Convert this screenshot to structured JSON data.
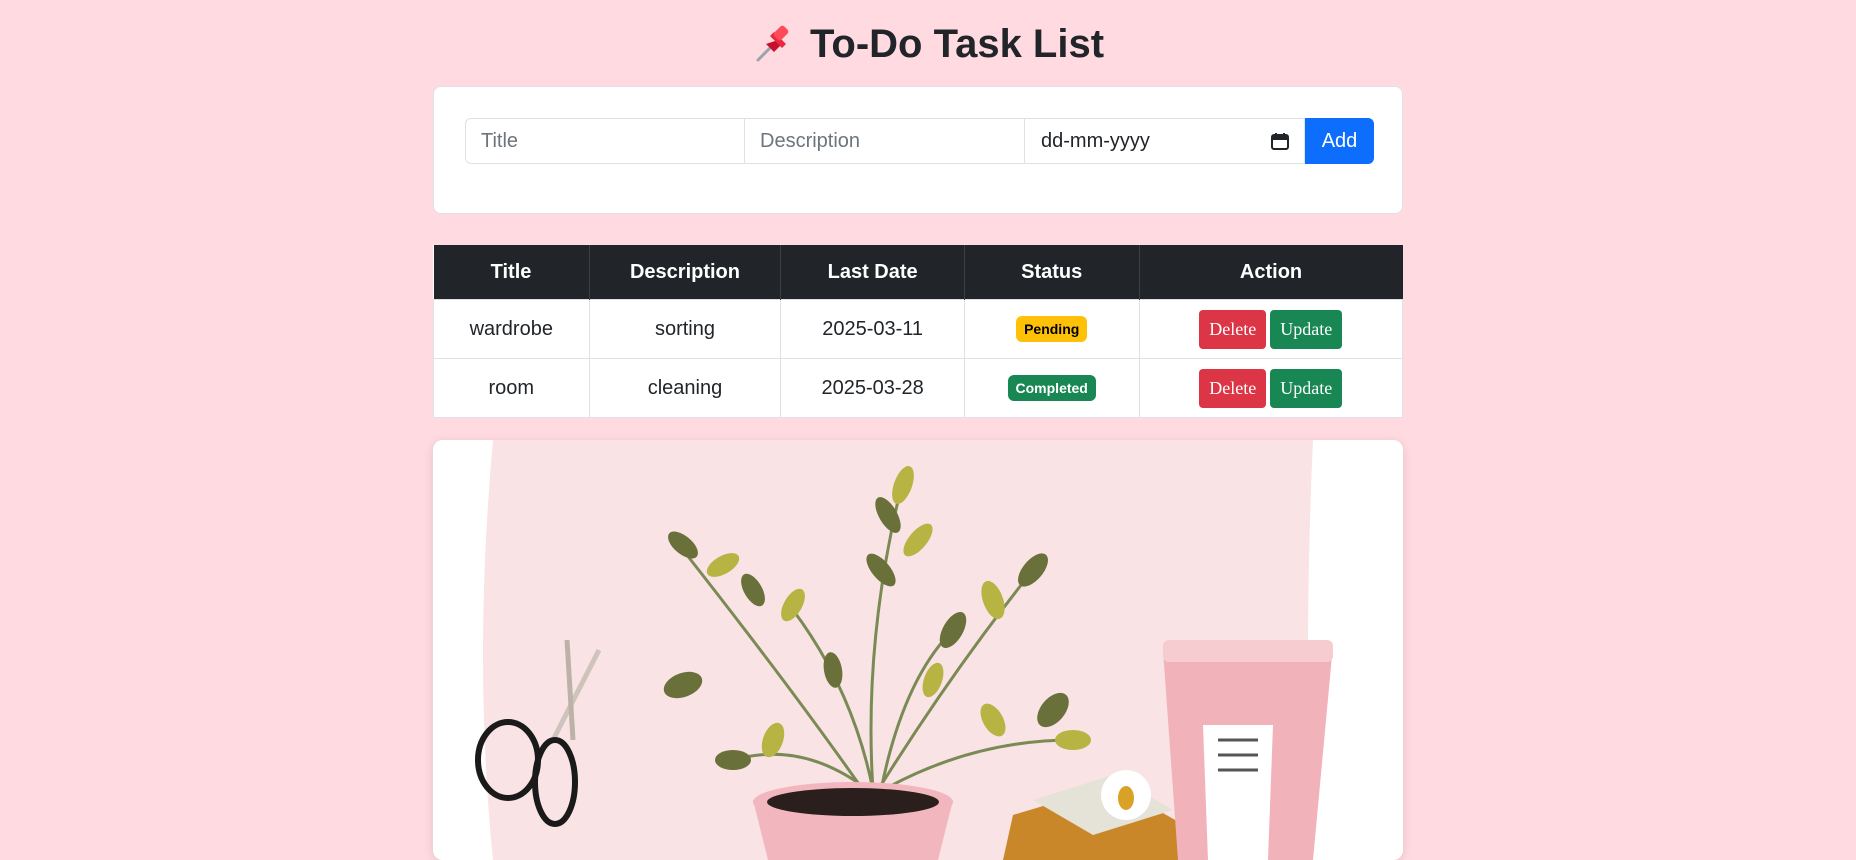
{
  "header": {
    "title": "To-Do Task List",
    "icon": "pushpin-icon"
  },
  "form": {
    "title_placeholder": "Title",
    "description_placeholder": "Description",
    "date_placeholder": "dd-mm-yyyy",
    "add_label": "Add"
  },
  "table": {
    "columns": [
      "Title",
      "Description",
      "Last Date",
      "Status",
      "Action"
    ],
    "rows": [
      {
        "title": "wardrobe",
        "description": "sorting",
        "last_date": "2025-03-11",
        "status": "Pending",
        "delete_label": "Delete",
        "update_label": "Update"
      },
      {
        "title": "room",
        "description": "cleaning",
        "last_date": "2025-03-28",
        "status": "Completed",
        "delete_label": "Delete",
        "update_label": "Update"
      }
    ]
  },
  "colors": {
    "background": "#ffdbe1",
    "primary": "#0d6efd",
    "danger": "#dc3545",
    "success": "#198754",
    "warning": "#ffc107",
    "dark": "#212529"
  }
}
